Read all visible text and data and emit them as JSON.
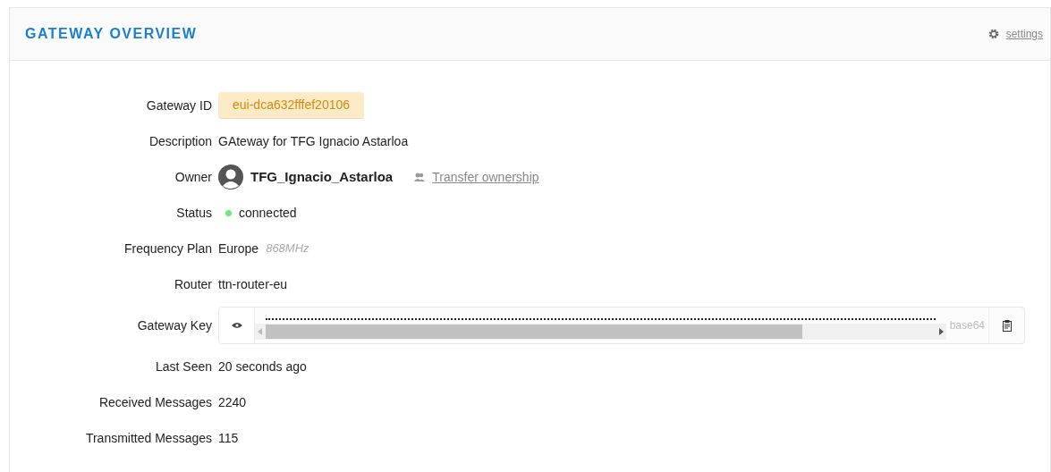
{
  "header": {
    "title": "GATEWAY OVERVIEW",
    "settings_link": "settings"
  },
  "rows": [
    {
      "kind": "badge",
      "label": "Gateway ID",
      "value": "eui-dca632fffef20106"
    },
    {
      "kind": "text",
      "label": "Description",
      "value": "GAteway for TFG Ignacio Astarloa"
    },
    {
      "kind": "owner",
      "label": "Owner",
      "value": "TFG_Ignacio_Astarloa",
      "link": "Transfer ownership"
    },
    {
      "kind": "status",
      "label": "Status",
      "value": "connected",
      "color": "#6ee87a"
    },
    {
      "kind": "plan",
      "label": "Frequency Plan",
      "value": "Europe",
      "note": "868MHz"
    },
    {
      "kind": "text",
      "label": "Router",
      "value": "ttn-router-eu"
    },
    {
      "kind": "key",
      "label": "Gateway Key",
      "masked": true,
      "encoding": "base64"
    },
    {
      "kind": "text",
      "label": "Last Seen",
      "value": "20 seconds ago"
    },
    {
      "kind": "text",
      "label": "Received Messages",
      "value": "2240"
    },
    {
      "kind": "text",
      "label": "Transmitted Messages",
      "value": "115"
    }
  ]
}
